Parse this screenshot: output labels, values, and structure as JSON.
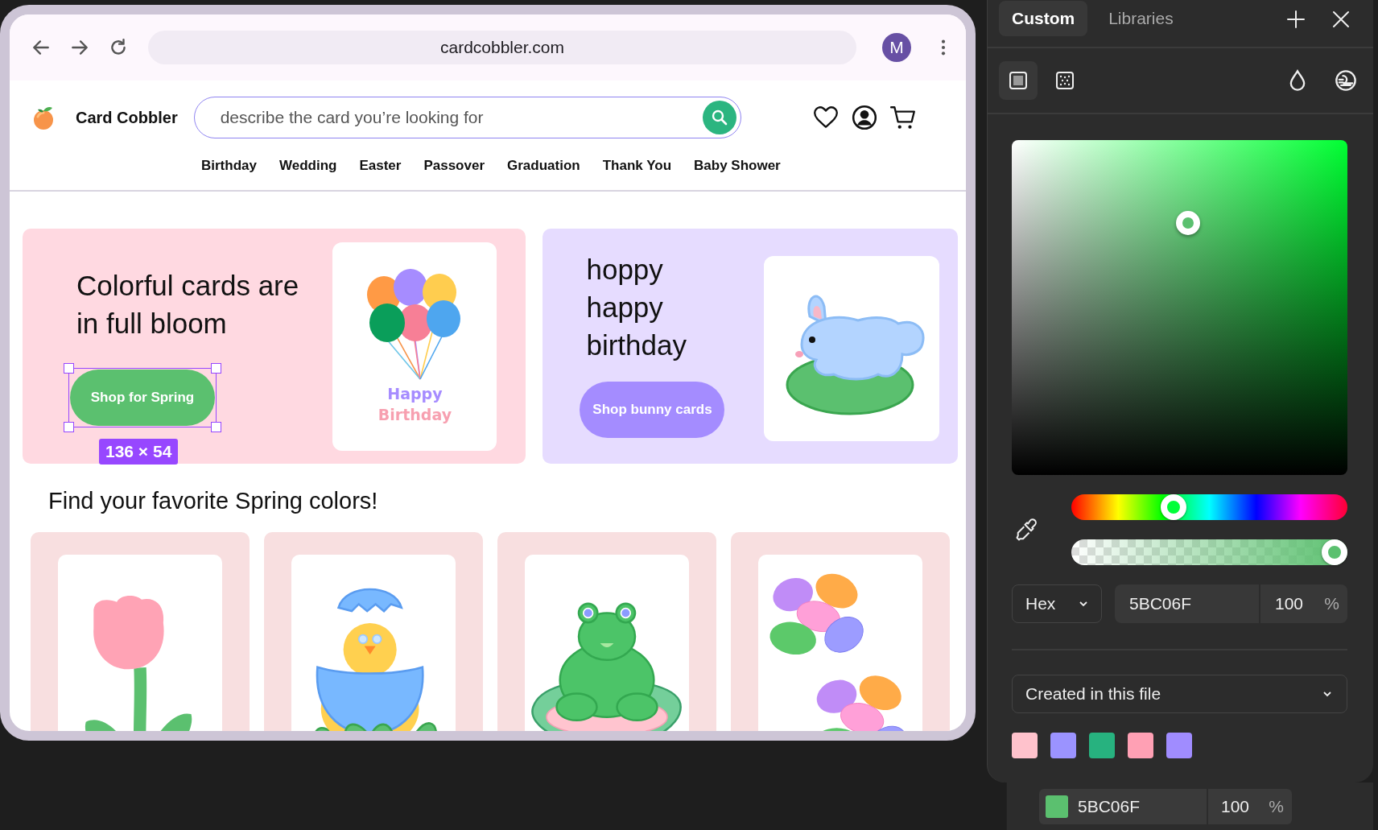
{
  "browser": {
    "url": "cardcobbler.com",
    "profile_initial": "M"
  },
  "site": {
    "brand": "Card Cobbler",
    "search": {
      "placeholder": "describe the card you’re looking for"
    },
    "nav": [
      "Birthday",
      "Wedding",
      "Easter",
      "Passover",
      "Graduation",
      "Thank You",
      "Baby Shower"
    ]
  },
  "hero_cards": [
    {
      "kind": "spring",
      "headline": "Colorful cards are in full bloom",
      "button": "Shop for Spring",
      "card_text": [
        "Happy",
        "Birthday"
      ],
      "selection_size": "136 × 54"
    },
    {
      "kind": "bunny",
      "headline": "hoppy happy birthday",
      "button": "Shop bunny cards"
    }
  ],
  "section_title": "Find your favorite Spring colors!",
  "products": [
    {
      "kind": "tulip"
    },
    {
      "kind": "chick"
    },
    {
      "kind": "frog"
    },
    {
      "kind": "jellybeans"
    }
  ],
  "color_panel": {
    "tabs": [
      {
        "label": "Custom",
        "selected": true
      },
      {
        "label": "Libraries",
        "selected": false
      }
    ],
    "fill_types": [
      {
        "kind": "solid",
        "selected": true
      },
      {
        "kind": "image",
        "selected": false
      }
    ],
    "hue": {
      "level": 0.37
    },
    "opacity": {
      "level": 1
    },
    "format": "Hex",
    "hex": "5BC06F",
    "alpha": "100",
    "alpha_unit": "%",
    "library": "Created in this file",
    "swatches": [
      {
        "color": "#ffc2cc"
      },
      {
        "color": "#9b93ff"
      },
      {
        "color": "#27b27f"
      },
      {
        "color": "#ffa0b4"
      },
      {
        "color": "#a08cff"
      }
    ]
  },
  "fill_row": {
    "hex": "5BC06F",
    "alpha": "100",
    "alpha_unit": "%"
  }
}
